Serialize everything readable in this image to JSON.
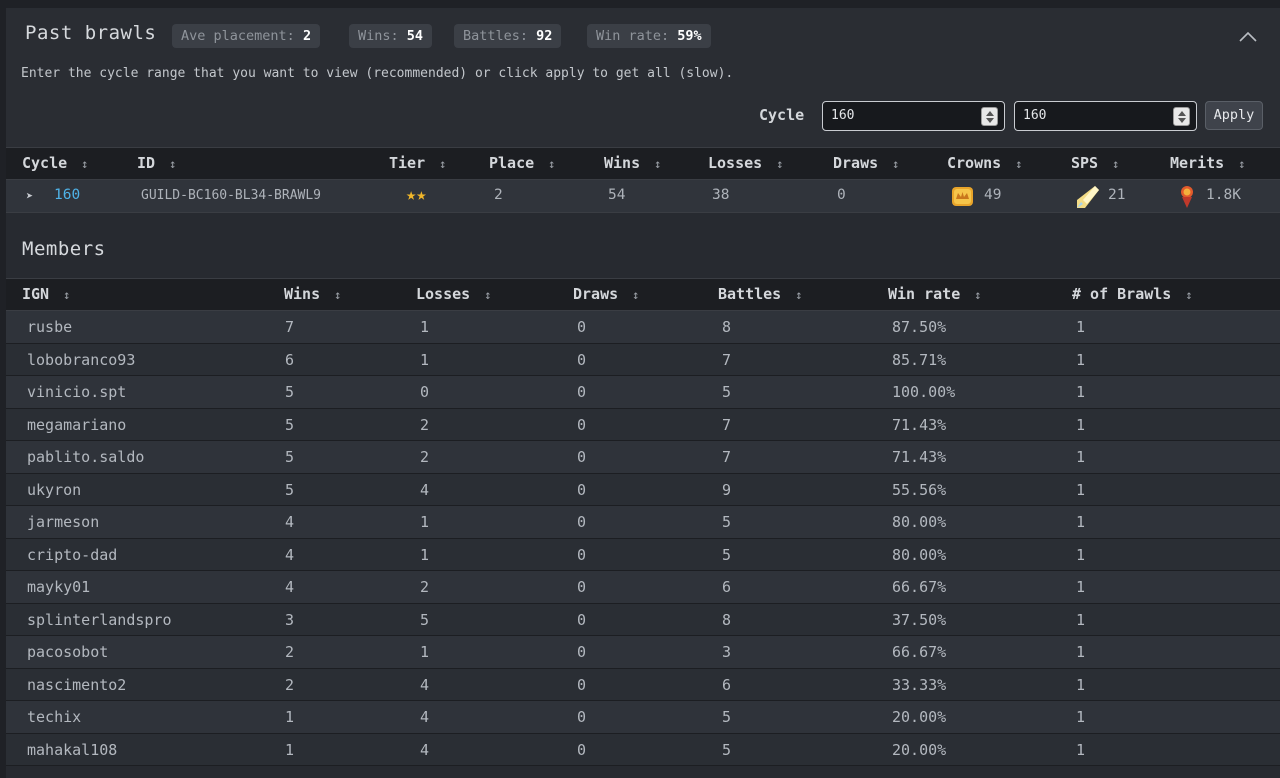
{
  "header": {
    "title": "Past brawls",
    "badges": [
      {
        "label": "Ave placement:",
        "value": "2"
      },
      {
        "label": "Wins:",
        "value": "54"
      },
      {
        "label": "Battles:",
        "value": "92"
      },
      {
        "label": "Win rate:",
        "value": "59%"
      }
    ],
    "collapse_icon": "chevron-up-icon",
    "hint": "Enter the cycle range that you want to view (recommended) or click apply to get all (slow).",
    "cycle_label": "Cycle",
    "cycle_from": "160",
    "cycle_to": "160",
    "apply_label": "Apply"
  },
  "brawls_table": {
    "columns": [
      "Cycle",
      "ID",
      "Tier",
      "Place",
      "Wins",
      "Losses",
      "Draws",
      "Crowns",
      "SPS",
      "Merits"
    ],
    "sort_icon": "sort-arrows-icon",
    "rows": [
      {
        "cycle": "160",
        "id": "GUILD-BC160-BL34-BRAWL9",
        "tier_stars": "★★",
        "place": "2",
        "wins": "54",
        "losses": "38",
        "draws": "0",
        "crowns": "49",
        "sps": "21",
        "merits": "1.8K"
      }
    ],
    "icons": {
      "crowns": "crown-chest-icon",
      "sps": "sps-token-icon",
      "merits": "merits-icon"
    },
    "colors": {
      "stars": "#f0b62a",
      "cycle_link": "#4fb3e8"
    }
  },
  "members": {
    "title": "Members",
    "columns": [
      "IGN",
      "Wins",
      "Losses",
      "Draws",
      "Battles",
      "Win rate",
      "# of Brawls"
    ],
    "rows": [
      [
        "rusbe",
        "7",
        "1",
        "0",
        "8",
        "87.50%",
        "1"
      ],
      [
        "lobobranco93",
        "6",
        "1",
        "0",
        "7",
        "85.71%",
        "1"
      ],
      [
        "vinicio.spt",
        "5",
        "0",
        "0",
        "5",
        "100.00%",
        "1"
      ],
      [
        "megamariano",
        "5",
        "2",
        "0",
        "7",
        "71.43%",
        "1"
      ],
      [
        "pablito.saldo",
        "5",
        "2",
        "0",
        "7",
        "71.43%",
        "1"
      ],
      [
        "ukyron",
        "5",
        "4",
        "0",
        "9",
        "55.56%",
        "1"
      ],
      [
        "jarmeson",
        "4",
        "1",
        "0",
        "5",
        "80.00%",
        "1"
      ],
      [
        "cripto-dad",
        "4",
        "1",
        "0",
        "5",
        "80.00%",
        "1"
      ],
      [
        "mayky01",
        "4",
        "2",
        "0",
        "6",
        "66.67%",
        "1"
      ],
      [
        "splinterlandspro",
        "3",
        "5",
        "0",
        "8",
        "37.50%",
        "1"
      ],
      [
        "pacosobot",
        "2",
        "1",
        "0",
        "3",
        "66.67%",
        "1"
      ],
      [
        "nascimento2",
        "2",
        "4",
        "0",
        "6",
        "33.33%",
        "1"
      ],
      [
        "techix",
        "1",
        "4",
        "0",
        "5",
        "20.00%",
        "1"
      ],
      [
        "mahakal108",
        "1",
        "4",
        "0",
        "5",
        "20.00%",
        "1"
      ]
    ]
  }
}
